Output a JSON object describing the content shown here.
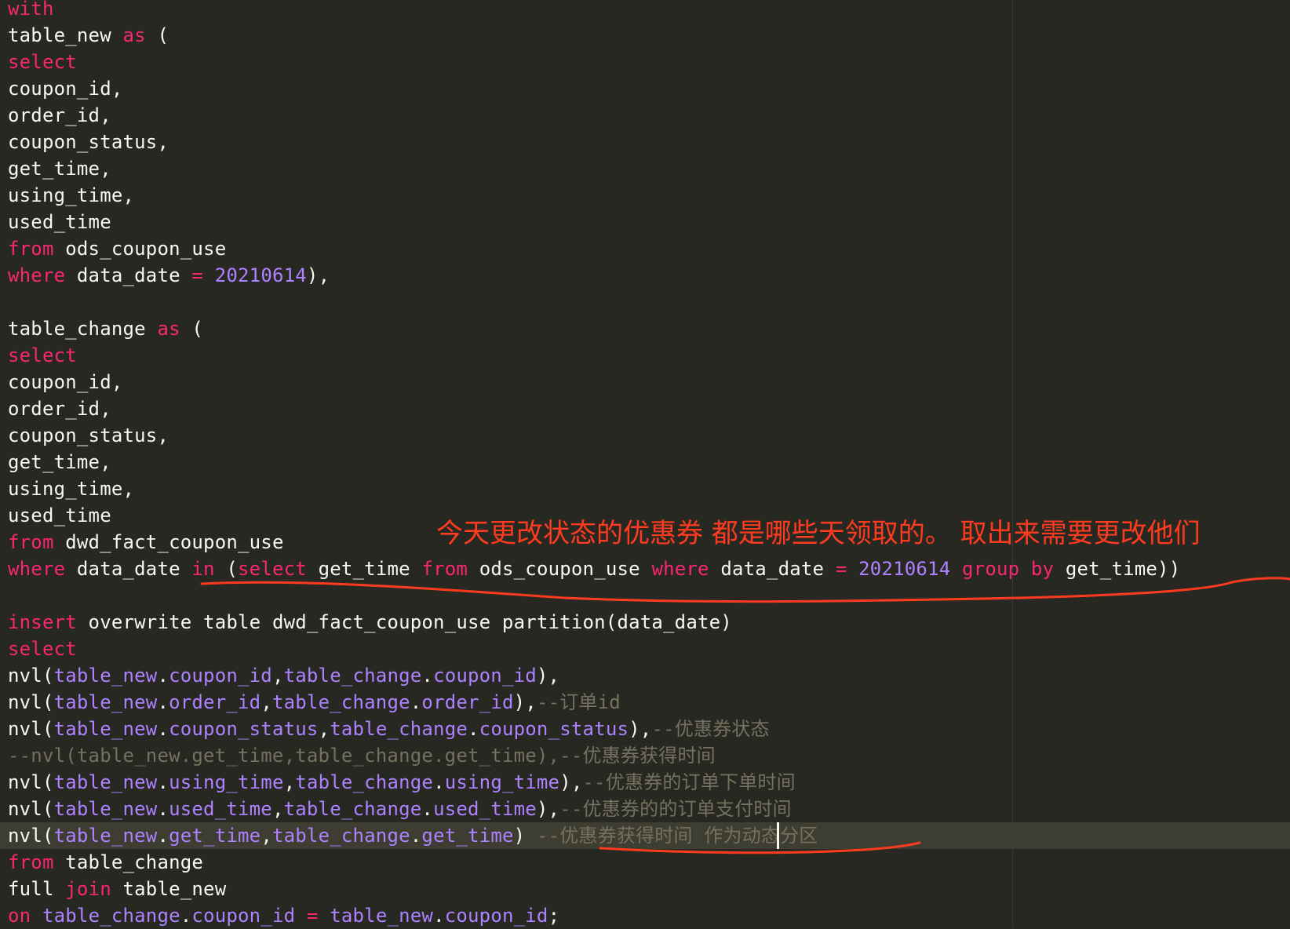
{
  "editor": {
    "lines": [
      [
        {
          "t": "with",
          "c": "kw"
        }
      ],
      [
        {
          "t": "table_new ",
          "c": "id"
        },
        {
          "t": "as",
          "c": "kw"
        },
        {
          "t": " (",
          "c": "punc"
        }
      ],
      [
        {
          "t": "select",
          "c": "kw"
        }
      ],
      [
        {
          "t": "coupon_id,",
          "c": "id"
        }
      ],
      [
        {
          "t": "order_id,",
          "c": "id"
        }
      ],
      [
        {
          "t": "coupon_status,",
          "c": "id"
        }
      ],
      [
        {
          "t": "get_time,",
          "c": "id"
        }
      ],
      [
        {
          "t": "using_time,",
          "c": "id"
        }
      ],
      [
        {
          "t": "used_time",
          "c": "id"
        }
      ],
      [
        {
          "t": "from",
          "c": "kw"
        },
        {
          "t": " ods_coupon_use",
          "c": "id"
        }
      ],
      [
        {
          "t": "where",
          "c": "kw"
        },
        {
          "t": " data_date ",
          "c": "id"
        },
        {
          "t": "=",
          "c": "kw"
        },
        {
          "t": " ",
          "c": "id"
        },
        {
          "t": "20210614",
          "c": "num"
        },
        {
          "t": "),",
          "c": "punc"
        }
      ],
      [],
      [
        {
          "t": "table_change ",
          "c": "id"
        },
        {
          "t": "as",
          "c": "kw"
        },
        {
          "t": " (",
          "c": "punc"
        }
      ],
      [
        {
          "t": "select",
          "c": "kw"
        }
      ],
      [
        {
          "t": "coupon_id,",
          "c": "id"
        }
      ],
      [
        {
          "t": "order_id,",
          "c": "id"
        }
      ],
      [
        {
          "t": "coupon_status,",
          "c": "id"
        }
      ],
      [
        {
          "t": "get_time,",
          "c": "id"
        }
      ],
      [
        {
          "t": "using_time,",
          "c": "id"
        }
      ],
      [
        {
          "t": "used_time",
          "c": "id"
        }
      ],
      [
        {
          "t": "from",
          "c": "kw"
        },
        {
          "t": " dwd_fact_coupon_use",
          "c": "id"
        }
      ],
      [
        {
          "t": "where",
          "c": "kw"
        },
        {
          "t": " data_date ",
          "c": "id"
        },
        {
          "t": "in",
          "c": "kw"
        },
        {
          "t": " (",
          "c": "punc"
        },
        {
          "t": "select",
          "c": "kw"
        },
        {
          "t": " get_time ",
          "c": "id"
        },
        {
          "t": "from",
          "c": "kw"
        },
        {
          "t": " ods_coupon_use ",
          "c": "id"
        },
        {
          "t": "where",
          "c": "kw"
        },
        {
          "t": " data_date ",
          "c": "id"
        },
        {
          "t": "=",
          "c": "kw"
        },
        {
          "t": " ",
          "c": "id"
        },
        {
          "t": "20210614",
          "c": "num"
        },
        {
          "t": " ",
          "c": "id"
        },
        {
          "t": "group by",
          "c": "kw"
        },
        {
          "t": " get_time))",
          "c": "id"
        }
      ],
      [],
      [
        {
          "t": "insert",
          "c": "kw"
        },
        {
          "t": " overwrite table dwd_fact_coupon_use partition(data_date)",
          "c": "id"
        }
      ],
      [
        {
          "t": "select",
          "c": "kw"
        }
      ],
      [
        {
          "t": "nvl(",
          "c": "id"
        },
        {
          "t": "table_new",
          "c": "col"
        },
        {
          "t": ".",
          "c": "punc"
        },
        {
          "t": "coupon_id",
          "c": "col"
        },
        {
          "t": ",",
          "c": "punc"
        },
        {
          "t": "table_change",
          "c": "col"
        },
        {
          "t": ".",
          "c": "punc"
        },
        {
          "t": "coupon_id",
          "c": "col"
        },
        {
          "t": "),",
          "c": "punc"
        }
      ],
      [
        {
          "t": "nvl(",
          "c": "id"
        },
        {
          "t": "table_new",
          "c": "col"
        },
        {
          "t": ".",
          "c": "punc"
        },
        {
          "t": "order_id",
          "c": "col"
        },
        {
          "t": ",",
          "c": "punc"
        },
        {
          "t": "table_change",
          "c": "col"
        },
        {
          "t": ".",
          "c": "punc"
        },
        {
          "t": "order_id",
          "c": "col"
        },
        {
          "t": "),",
          "c": "punc"
        },
        {
          "t": "--订单id",
          "c": "cm"
        }
      ],
      [
        {
          "t": "nvl(",
          "c": "id"
        },
        {
          "t": "table_new",
          "c": "col"
        },
        {
          "t": ".",
          "c": "punc"
        },
        {
          "t": "coupon_status",
          "c": "col"
        },
        {
          "t": ",",
          "c": "punc"
        },
        {
          "t": "table_change",
          "c": "col"
        },
        {
          "t": ".",
          "c": "punc"
        },
        {
          "t": "coupon_status",
          "c": "col"
        },
        {
          "t": "),",
          "c": "punc"
        },
        {
          "t": "--优惠券状态",
          "c": "cm"
        }
      ],
      [
        {
          "t": "--nvl(table_new.get_time,table_change.get_time),--优惠券获得时间",
          "c": "cm"
        }
      ],
      [
        {
          "t": "nvl(",
          "c": "id"
        },
        {
          "t": "table_new",
          "c": "col"
        },
        {
          "t": ".",
          "c": "punc"
        },
        {
          "t": "using_time",
          "c": "col"
        },
        {
          "t": ",",
          "c": "punc"
        },
        {
          "t": "table_change",
          "c": "col"
        },
        {
          "t": ".",
          "c": "punc"
        },
        {
          "t": "using_time",
          "c": "col"
        },
        {
          "t": "),",
          "c": "punc"
        },
        {
          "t": "--优惠券的订单下单时间",
          "c": "cm"
        }
      ],
      [
        {
          "t": "nvl(",
          "c": "id"
        },
        {
          "t": "table_new",
          "c": "col"
        },
        {
          "t": ".",
          "c": "punc"
        },
        {
          "t": "used_time",
          "c": "col"
        },
        {
          "t": ",",
          "c": "punc"
        },
        {
          "t": "table_change",
          "c": "col"
        },
        {
          "t": ".",
          "c": "punc"
        },
        {
          "t": "used_time",
          "c": "col"
        },
        {
          "t": "),",
          "c": "punc"
        },
        {
          "t": "--优惠券的的订单支付时间",
          "c": "cm"
        }
      ],
      [
        {
          "t": "nvl(",
          "c": "id"
        },
        {
          "t": "table_new",
          "c": "col"
        },
        {
          "t": ".",
          "c": "punc"
        },
        {
          "t": "get_time",
          "c": "col"
        },
        {
          "t": ",",
          "c": "punc"
        },
        {
          "t": "table_change",
          "c": "col"
        },
        {
          "t": ".",
          "c": "punc"
        },
        {
          "t": "get_time",
          "c": "col"
        },
        {
          "t": ") ",
          "c": "punc"
        },
        {
          "t": "--优惠券获得时间 作为动态分区",
          "c": "cm"
        }
      ],
      [
        {
          "t": "from",
          "c": "kw"
        },
        {
          "t": " table_change",
          "c": "id"
        }
      ],
      [
        {
          "t": "full ",
          "c": "id"
        },
        {
          "t": "join",
          "c": "kw"
        },
        {
          "t": " table_new",
          "c": "id"
        }
      ],
      [
        {
          "t": "on",
          "c": "kw"
        },
        {
          "t": " ",
          "c": "id"
        },
        {
          "t": "table_change",
          "c": "col"
        },
        {
          "t": ".",
          "c": "punc"
        },
        {
          "t": "coupon_id",
          "c": "col"
        },
        {
          "t": " ",
          "c": "id"
        },
        {
          "t": "=",
          "c": "kw"
        },
        {
          "t": " ",
          "c": "id"
        },
        {
          "t": "table_new",
          "c": "col"
        },
        {
          "t": ".",
          "c": "punc"
        },
        {
          "t": "coupon_id",
          "c": "col"
        },
        {
          "t": ";",
          "c": "punc"
        }
      ]
    ],
    "current_line": 31
  },
  "annotation": {
    "text": "今天更改状态的优惠券 都是哪些天领取的。 取出来需要更改他们",
    "color": "#ff3b1f"
  },
  "theme": {
    "background": "#272822",
    "keyword": "#f92672",
    "identifier": "#f8f8f2",
    "number": "#ae81ff",
    "comment": "#75715e"
  }
}
